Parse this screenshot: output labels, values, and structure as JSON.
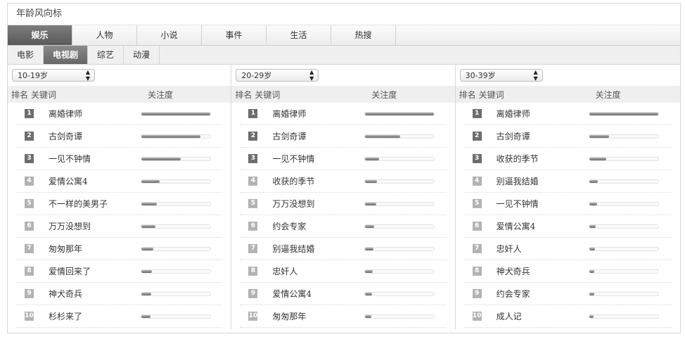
{
  "title": "年龄风向标",
  "main_tabs": [
    {
      "label": "娱乐",
      "active": true
    },
    {
      "label": "人物",
      "active": false
    },
    {
      "label": "小说",
      "active": false
    },
    {
      "label": "事件",
      "active": false
    },
    {
      "label": "生活",
      "active": false
    },
    {
      "label": "热搜",
      "active": false
    }
  ],
  "sub_tabs": [
    {
      "label": "电影",
      "active": false
    },
    {
      "label": "电视剧",
      "active": true
    },
    {
      "label": "综艺",
      "active": false
    },
    {
      "label": "动漫",
      "active": false
    }
  ],
  "table_headers": {
    "rank": "排名",
    "keyword": "关键词",
    "attention": "关注度"
  },
  "columns": [
    {
      "age_group": "10-19岁",
      "items": [
        {
          "rank": "1",
          "keyword": "离婚律师",
          "attention": 1.0
        },
        {
          "rank": "2",
          "keyword": "古剑奇谭",
          "attention": 0.86
        },
        {
          "rank": "3",
          "keyword": "一见不钟情",
          "attention": 0.57
        },
        {
          "rank": "4",
          "keyword": "爱情公寓4",
          "attention": 0.27
        },
        {
          "rank": "5",
          "keyword": "不一样的美男子",
          "attention": 0.22
        },
        {
          "rank": "6",
          "keyword": "万万没想到",
          "attention": 0.2
        },
        {
          "rank": "7",
          "keyword": "匆匆那年",
          "attention": 0.17
        },
        {
          "rank": "8",
          "keyword": "爱情回来了",
          "attention": 0.15
        },
        {
          "rank": "9",
          "keyword": "神犬奇兵",
          "attention": 0.14
        },
        {
          "rank": "10",
          "keyword": "杉杉来了",
          "attention": 0.13
        }
      ]
    },
    {
      "age_group": "20-29岁",
      "items": [
        {
          "rank": "1",
          "keyword": "离婚律师",
          "attention": 1.0
        },
        {
          "rank": "2",
          "keyword": "古剑奇谭",
          "attention": 0.51
        },
        {
          "rank": "3",
          "keyword": "一见不钟情",
          "attention": 0.2
        },
        {
          "rank": "4",
          "keyword": "收获的季节",
          "attention": 0.17
        },
        {
          "rank": "5",
          "keyword": "万万没想到",
          "attention": 0.16
        },
        {
          "rank": "6",
          "keyword": "约会专家",
          "attention": 0.13
        },
        {
          "rank": "7",
          "keyword": "别逼我结婚",
          "attention": 0.12
        },
        {
          "rank": "8",
          "keyword": "忠奸人",
          "attention": 0.11
        },
        {
          "rank": "9",
          "keyword": "爱情公寓4",
          "attention": 0.1
        },
        {
          "rank": "10",
          "keyword": "匆匆那年",
          "attention": 0.09
        }
      ]
    },
    {
      "age_group": "30-39岁",
      "items": [
        {
          "rank": "1",
          "keyword": "离婚律师",
          "attention": 1.0
        },
        {
          "rank": "2",
          "keyword": "古剑奇谭",
          "attention": 0.29
        },
        {
          "rank": "3",
          "keyword": "收获的季节",
          "attention": 0.25
        },
        {
          "rank": "4",
          "keyword": "别逼我结婚",
          "attention": 0.13
        },
        {
          "rank": "5",
          "keyword": "一见不钟情",
          "attention": 0.12
        },
        {
          "rank": "6",
          "keyword": "爱情公寓4",
          "attention": 0.1
        },
        {
          "rank": "7",
          "keyword": "忠奸人",
          "attention": 0.09
        },
        {
          "rank": "8",
          "keyword": "神犬奇兵",
          "attention": 0.08
        },
        {
          "rank": "9",
          "keyword": "约会专家",
          "attention": 0.07
        },
        {
          "rank": "10",
          "keyword": "成人记",
          "attention": 0.06
        }
      ]
    }
  ],
  "colors": {
    "active_tab": "#6a6a6a",
    "rank_top": "#6d6d6d",
    "rank_rest": "#b3b3b3",
    "bar_dark": "#666666"
  }
}
